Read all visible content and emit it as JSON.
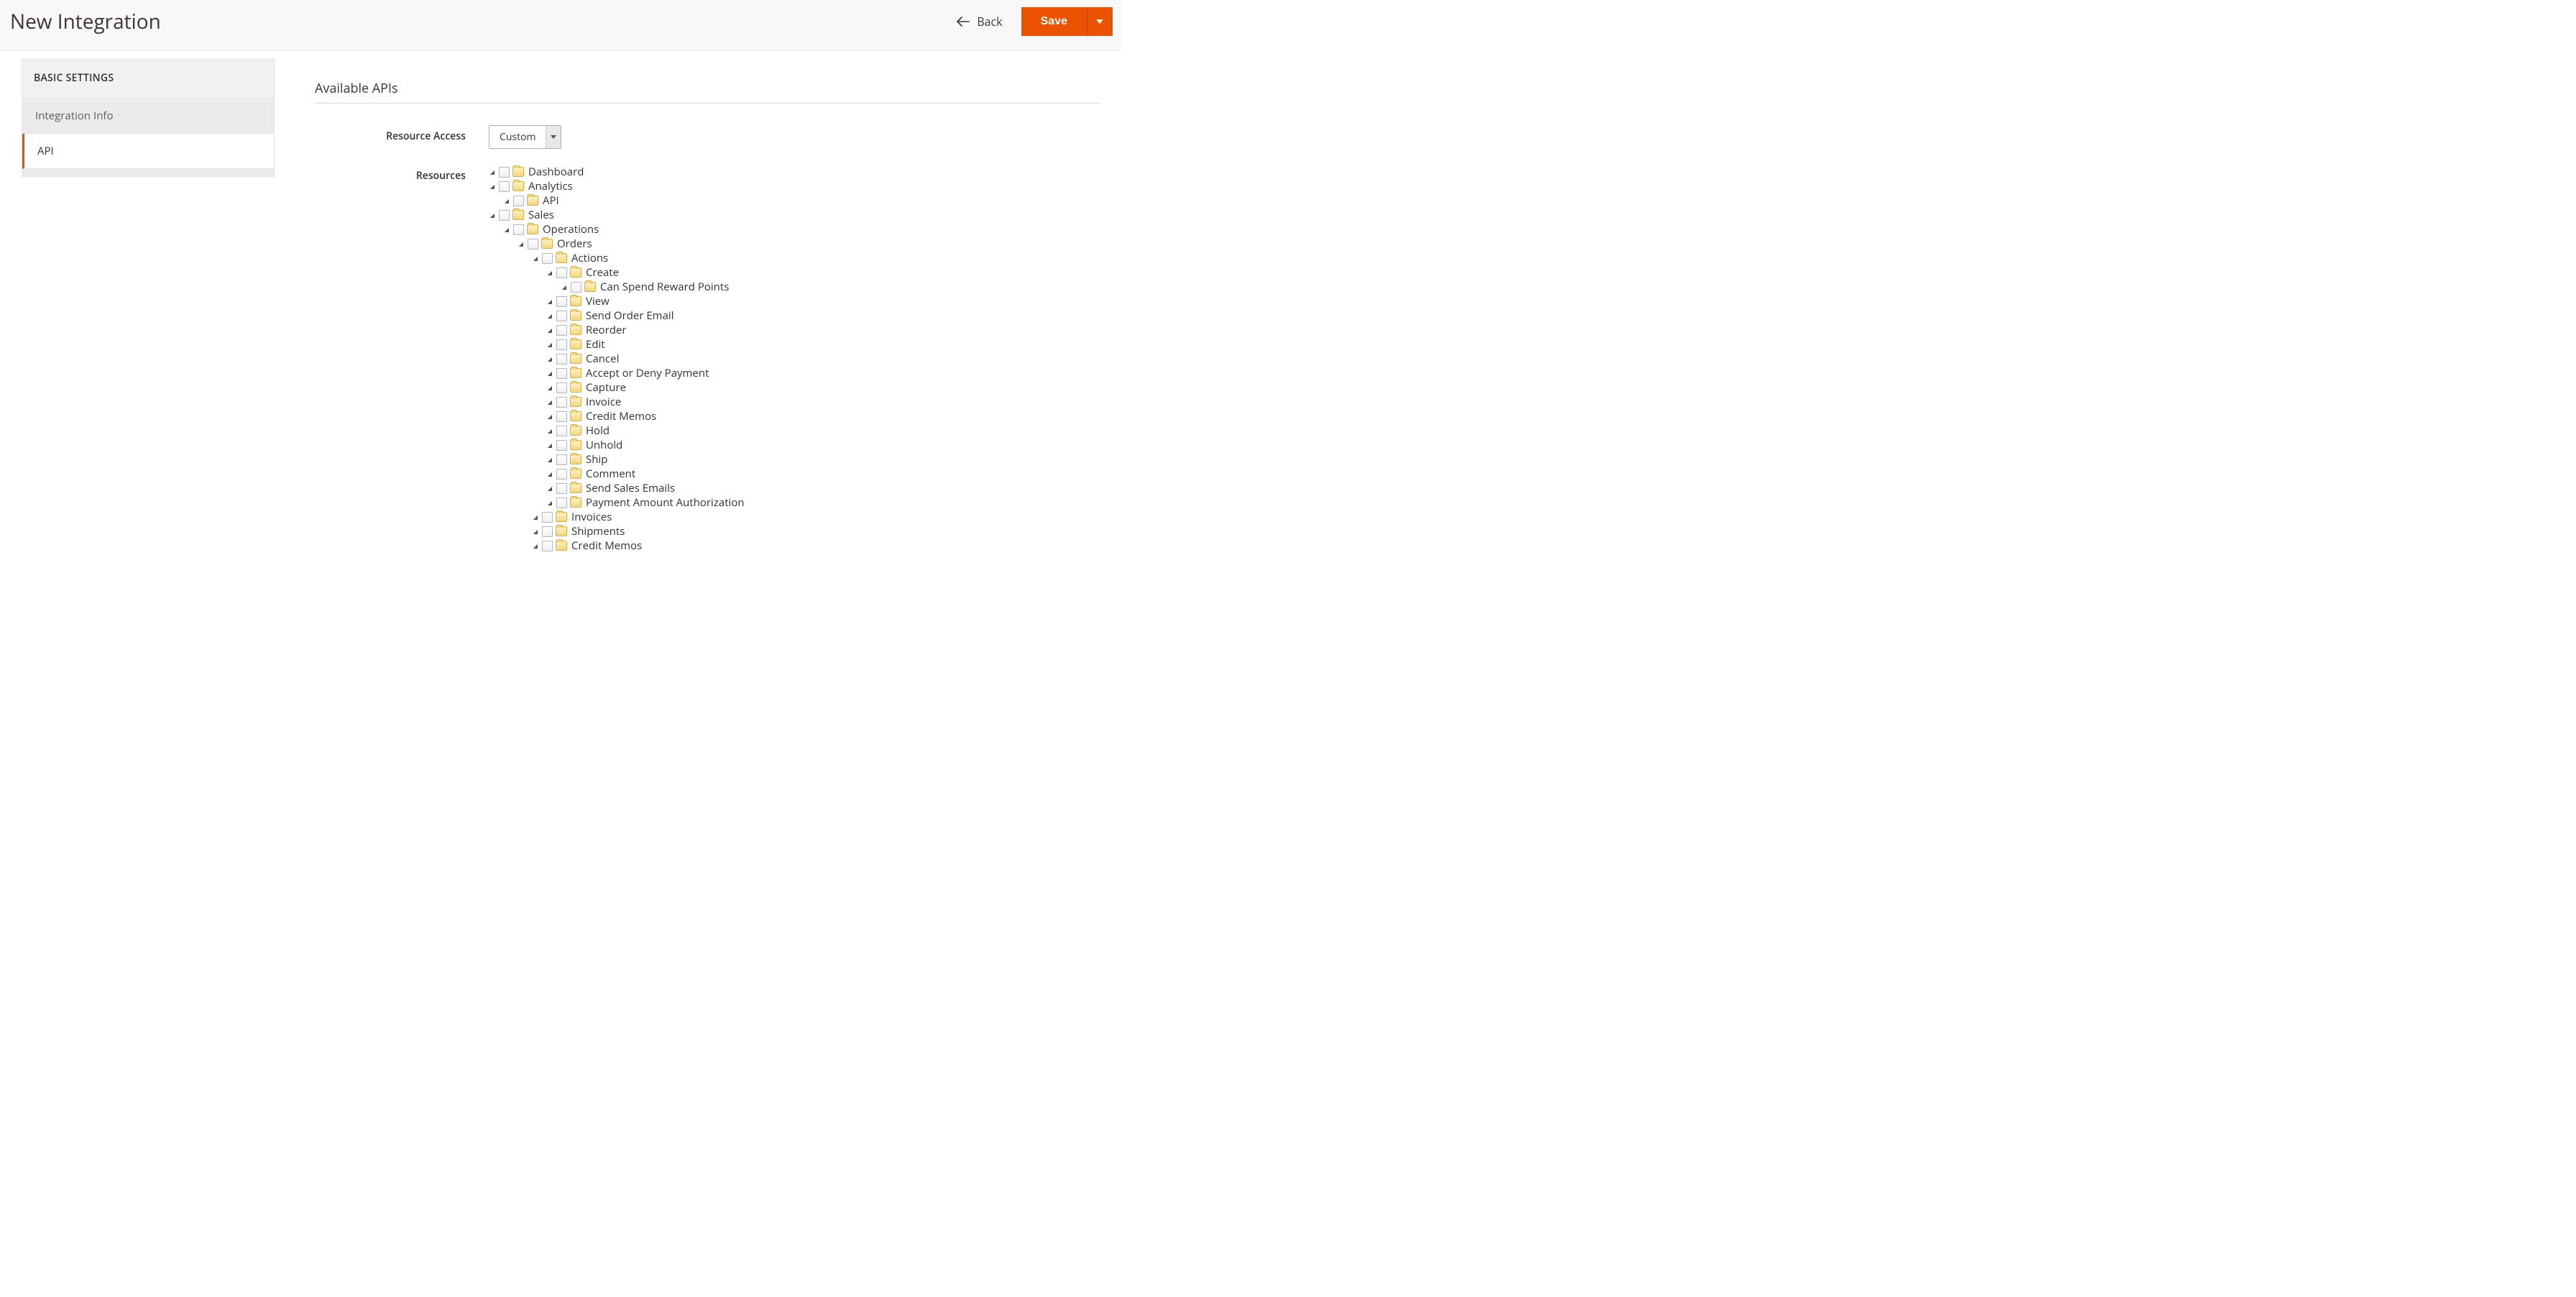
{
  "header": {
    "title": "New Integration",
    "back_label": "Back",
    "save_label": "Save"
  },
  "sidebar": {
    "heading": "BASIC SETTINGS",
    "items": [
      {
        "label": "Integration Info",
        "active": false
      },
      {
        "label": "API",
        "active": true
      }
    ]
  },
  "main": {
    "section_title": "Available APIs",
    "resource_access_label": "Resource Access",
    "resource_access_value": "Custom",
    "resources_label": "Resources"
  },
  "tree": [
    {
      "label": "Dashboard",
      "hasChildren": true
    },
    {
      "label": "Analytics",
      "hasChildren": true,
      "children": [
        {
          "label": "API",
          "hasChildren": true
        }
      ]
    },
    {
      "label": "Sales",
      "hasChildren": true,
      "children": [
        {
          "label": "Operations",
          "hasChildren": true,
          "children": [
            {
              "label": "Orders",
              "hasChildren": true,
              "children": [
                {
                  "label": "Actions",
                  "hasChildren": true,
                  "children": [
                    {
                      "label": "Create",
                      "hasChildren": true,
                      "children": [
                        {
                          "label": "Can Spend Reward Points",
                          "hasChildren": true
                        }
                      ]
                    },
                    {
                      "label": "View",
                      "hasChildren": true
                    },
                    {
                      "label": "Send Order Email",
                      "hasChildren": true
                    },
                    {
                      "label": "Reorder",
                      "hasChildren": true
                    },
                    {
                      "label": "Edit",
                      "hasChildren": true
                    },
                    {
                      "label": "Cancel",
                      "hasChildren": true
                    },
                    {
                      "label": "Accept or Deny Payment",
                      "hasChildren": true
                    },
                    {
                      "label": "Capture",
                      "hasChildren": true
                    },
                    {
                      "label": "Invoice",
                      "hasChildren": true
                    },
                    {
                      "label": "Credit Memos",
                      "hasChildren": true
                    },
                    {
                      "label": "Hold",
                      "hasChildren": true
                    },
                    {
                      "label": "Unhold",
                      "hasChildren": true
                    },
                    {
                      "label": "Ship",
                      "hasChildren": true
                    },
                    {
                      "label": "Comment",
                      "hasChildren": true
                    },
                    {
                      "label": "Send Sales Emails",
                      "hasChildren": true
                    },
                    {
                      "label": "Payment Amount Authorization",
                      "hasChildren": true
                    }
                  ]
                },
                {
                  "label": "Invoices",
                  "hasChildren": true
                },
                {
                  "label": "Shipments",
                  "hasChildren": true
                },
                {
                  "label": "Credit Memos",
                  "hasChildren": true
                }
              ]
            }
          ]
        }
      ]
    }
  ]
}
